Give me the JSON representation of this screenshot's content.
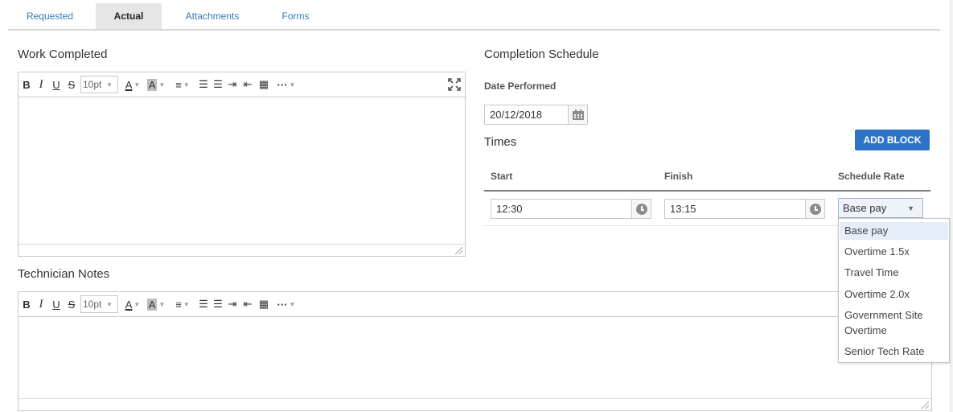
{
  "tabs": [
    {
      "label": "Requested"
    },
    {
      "label": "Actual"
    },
    {
      "label": "Attachments"
    },
    {
      "label": "Forms"
    }
  ],
  "work_completed": {
    "title": "Work Completed"
  },
  "technician_notes": {
    "title": "Technician Notes"
  },
  "editor_toolbar": {
    "bold": "B",
    "italic": "I",
    "underline": "U",
    "strike": "S",
    "font_size": "10pt",
    "text_color": "A",
    "bg_color": "A",
    "more": "···"
  },
  "completion_schedule": {
    "title": "Completion Schedule",
    "date_label": "Date Performed",
    "date_value": "20/12/2018",
    "times_title": "Times",
    "add_block": "ADD BLOCK",
    "columns": {
      "start": "Start",
      "finish": "Finish",
      "rate": "Schedule Rate"
    },
    "row": {
      "start": "12:30",
      "finish": "13:15",
      "rate": "Base pay"
    },
    "rate_options": [
      "Base pay",
      "Overtime 1.5x",
      "Travel Time",
      "Overtime 2.0x",
      "Government Site Overtime",
      "Senior Tech Rate"
    ]
  },
  "icons": {
    "calendar": "calendar-icon",
    "clock": "clock-icon",
    "expand": "fullscreen-icon",
    "caret": "chevron-down-icon"
  },
  "colors": {
    "accent": "#2d74c8",
    "link": "#337ab7",
    "active_tab_bg": "#e5e5e5"
  }
}
